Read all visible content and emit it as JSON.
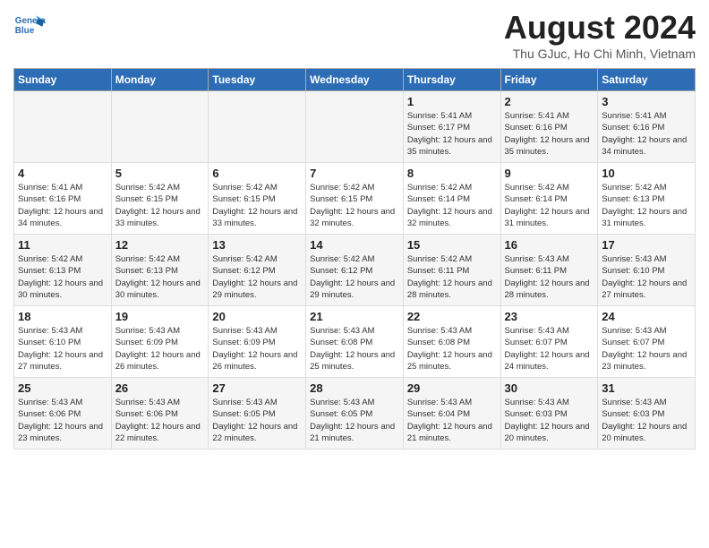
{
  "header": {
    "logo_general": "General",
    "logo_blue": "Blue",
    "title": "August 2024",
    "location": "Thu GJuc, Ho Chi Minh, Vietnam"
  },
  "days_of_week": [
    "Sunday",
    "Monday",
    "Tuesday",
    "Wednesday",
    "Thursday",
    "Friday",
    "Saturday"
  ],
  "weeks": [
    [
      {
        "day": "",
        "info": ""
      },
      {
        "day": "",
        "info": ""
      },
      {
        "day": "",
        "info": ""
      },
      {
        "day": "",
        "info": ""
      },
      {
        "day": "1",
        "info": "Sunrise: 5:41 AM\nSunset: 6:17 PM\nDaylight: 12 hours\nand 35 minutes."
      },
      {
        "day": "2",
        "info": "Sunrise: 5:41 AM\nSunset: 6:16 PM\nDaylight: 12 hours\nand 35 minutes."
      },
      {
        "day": "3",
        "info": "Sunrise: 5:41 AM\nSunset: 6:16 PM\nDaylight: 12 hours\nand 34 minutes."
      }
    ],
    [
      {
        "day": "4",
        "info": "Sunrise: 5:41 AM\nSunset: 6:16 PM\nDaylight: 12 hours\nand 34 minutes."
      },
      {
        "day": "5",
        "info": "Sunrise: 5:42 AM\nSunset: 6:15 PM\nDaylight: 12 hours\nand 33 minutes."
      },
      {
        "day": "6",
        "info": "Sunrise: 5:42 AM\nSunset: 6:15 PM\nDaylight: 12 hours\nand 33 minutes."
      },
      {
        "day": "7",
        "info": "Sunrise: 5:42 AM\nSunset: 6:15 PM\nDaylight: 12 hours\nand 32 minutes."
      },
      {
        "day": "8",
        "info": "Sunrise: 5:42 AM\nSunset: 6:14 PM\nDaylight: 12 hours\nand 32 minutes."
      },
      {
        "day": "9",
        "info": "Sunrise: 5:42 AM\nSunset: 6:14 PM\nDaylight: 12 hours\nand 31 minutes."
      },
      {
        "day": "10",
        "info": "Sunrise: 5:42 AM\nSunset: 6:13 PM\nDaylight: 12 hours\nand 31 minutes."
      }
    ],
    [
      {
        "day": "11",
        "info": "Sunrise: 5:42 AM\nSunset: 6:13 PM\nDaylight: 12 hours\nand 30 minutes."
      },
      {
        "day": "12",
        "info": "Sunrise: 5:42 AM\nSunset: 6:13 PM\nDaylight: 12 hours\nand 30 minutes."
      },
      {
        "day": "13",
        "info": "Sunrise: 5:42 AM\nSunset: 6:12 PM\nDaylight: 12 hours\nand 29 minutes."
      },
      {
        "day": "14",
        "info": "Sunrise: 5:42 AM\nSunset: 6:12 PM\nDaylight: 12 hours\nand 29 minutes."
      },
      {
        "day": "15",
        "info": "Sunrise: 5:42 AM\nSunset: 6:11 PM\nDaylight: 12 hours\nand 28 minutes."
      },
      {
        "day": "16",
        "info": "Sunrise: 5:43 AM\nSunset: 6:11 PM\nDaylight: 12 hours\nand 28 minutes."
      },
      {
        "day": "17",
        "info": "Sunrise: 5:43 AM\nSunset: 6:10 PM\nDaylight: 12 hours\nand 27 minutes."
      }
    ],
    [
      {
        "day": "18",
        "info": "Sunrise: 5:43 AM\nSunset: 6:10 PM\nDaylight: 12 hours\nand 27 minutes."
      },
      {
        "day": "19",
        "info": "Sunrise: 5:43 AM\nSunset: 6:09 PM\nDaylight: 12 hours\nand 26 minutes."
      },
      {
        "day": "20",
        "info": "Sunrise: 5:43 AM\nSunset: 6:09 PM\nDaylight: 12 hours\nand 26 minutes."
      },
      {
        "day": "21",
        "info": "Sunrise: 5:43 AM\nSunset: 6:08 PM\nDaylight: 12 hours\nand 25 minutes."
      },
      {
        "day": "22",
        "info": "Sunrise: 5:43 AM\nSunset: 6:08 PM\nDaylight: 12 hours\nand 25 minutes."
      },
      {
        "day": "23",
        "info": "Sunrise: 5:43 AM\nSunset: 6:07 PM\nDaylight: 12 hours\nand 24 minutes."
      },
      {
        "day": "24",
        "info": "Sunrise: 5:43 AM\nSunset: 6:07 PM\nDaylight: 12 hours\nand 23 minutes."
      }
    ],
    [
      {
        "day": "25",
        "info": "Sunrise: 5:43 AM\nSunset: 6:06 PM\nDaylight: 12 hours\nand 23 minutes."
      },
      {
        "day": "26",
        "info": "Sunrise: 5:43 AM\nSunset: 6:06 PM\nDaylight: 12 hours\nand 22 minutes."
      },
      {
        "day": "27",
        "info": "Sunrise: 5:43 AM\nSunset: 6:05 PM\nDaylight: 12 hours\nand 22 minutes."
      },
      {
        "day": "28",
        "info": "Sunrise: 5:43 AM\nSunset: 6:05 PM\nDaylight: 12 hours\nand 21 minutes."
      },
      {
        "day": "29",
        "info": "Sunrise: 5:43 AM\nSunset: 6:04 PM\nDaylight: 12 hours\nand 21 minutes."
      },
      {
        "day": "30",
        "info": "Sunrise: 5:43 AM\nSunset: 6:03 PM\nDaylight: 12 hours\nand 20 minutes."
      },
      {
        "day": "31",
        "info": "Sunrise: 5:43 AM\nSunset: 6:03 PM\nDaylight: 12 hours\nand 20 minutes."
      }
    ]
  ]
}
